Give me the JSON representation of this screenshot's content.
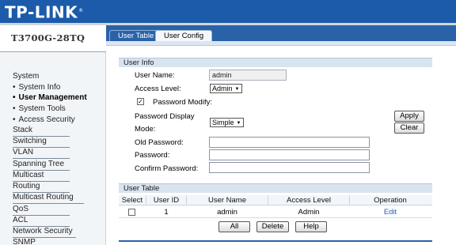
{
  "brand": {
    "logo_text": "TP-LINK",
    "reg_mark": "®"
  },
  "model": "T3700G-28TQ",
  "tabs": [
    {
      "label": "User Table",
      "active": true
    },
    {
      "label": "User Config",
      "active": false
    }
  ],
  "sidebar": {
    "items": [
      {
        "label": "System",
        "sub": false
      },
      {
        "label": "System Info",
        "sub": true
      },
      {
        "label": "User Management",
        "sub": true,
        "active": true
      },
      {
        "label": "System Tools",
        "sub": true
      },
      {
        "label": "Access Security",
        "sub": true
      },
      {
        "label": "Stack",
        "sub": false
      },
      {
        "label": "Switching",
        "sub": false
      },
      {
        "label": "VLAN",
        "sub": false
      },
      {
        "label": "Spanning Tree",
        "sub": false
      },
      {
        "label": "Multicast",
        "sub": false
      },
      {
        "label": "Routing",
        "sub": false
      },
      {
        "label": "Multicast Routing",
        "sub": false
      },
      {
        "label": "QoS",
        "sub": false
      },
      {
        "label": "ACL",
        "sub": false
      },
      {
        "label": "Network Security",
        "sub": false
      },
      {
        "label": "SNMP",
        "sub": false
      }
    ]
  },
  "user_info": {
    "title": "User Info",
    "user_name_label": "User Name:",
    "user_name_value": "admin",
    "access_level_label": "Access Level:",
    "access_level_value": "Admin",
    "password_modify_label": "Password Modify:",
    "password_modify_checked": true,
    "password_display_label_1": "Password Display",
    "password_display_label_2": "Mode:",
    "password_display_value": "Simple",
    "old_password_label": "Old Password:",
    "password_label": "Password:",
    "confirm_password_label": "Confirm Password:",
    "apply_label": "Apply",
    "clear_label": "Clear"
  },
  "user_table": {
    "title": "User Table",
    "columns": [
      "Select",
      "User ID",
      "User Name",
      "Access Level",
      "Operation"
    ],
    "rows": [
      {
        "user_id": "1",
        "user_name": "admin",
        "access_level": "Admin",
        "operation": "Edit"
      }
    ],
    "all_label": "All",
    "delete_label": "Delete",
    "help_label": "Help"
  },
  "icons": {
    "dropdown": "triangle-down-icon",
    "check": "checkmark-icon"
  }
}
